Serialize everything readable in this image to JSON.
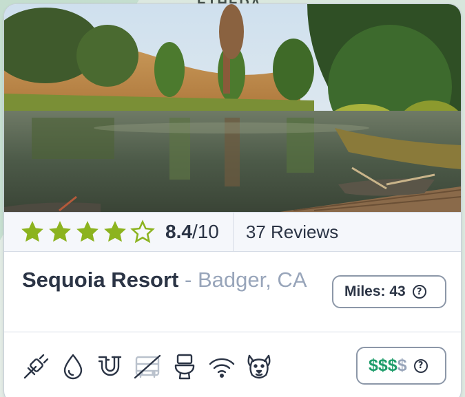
{
  "map": {
    "label": "ETHEDA"
  },
  "card": {
    "photo_alt": "lake with trees and wooden dock",
    "rating": {
      "stars_filled": 4,
      "stars_total": 5,
      "score": "8.4",
      "score_suffix": "/10",
      "reviews": "37 Reviews",
      "star_color": "#8cb31f"
    },
    "title": {
      "name": "Sequoia Resort",
      "separator": " - ",
      "location": "Badger, CA"
    },
    "miles": {
      "label": "Miles: 43",
      "help": "?"
    },
    "amenities": [
      {
        "icon": "electric-plug-icon",
        "available": true
      },
      {
        "icon": "water-drop-icon",
        "available": true
      },
      {
        "icon": "sewer-hookup-icon",
        "available": true
      },
      {
        "icon": "bus-icon",
        "available": false
      },
      {
        "icon": "toilet-icon",
        "available": true
      },
      {
        "icon": "wifi-icon",
        "available": true
      },
      {
        "icon": "pets-allowed-icon",
        "available": true
      }
    ],
    "price": {
      "active": "$$$",
      "inactive": "$",
      "help": "?",
      "active_color": "#1f9d6b"
    }
  }
}
